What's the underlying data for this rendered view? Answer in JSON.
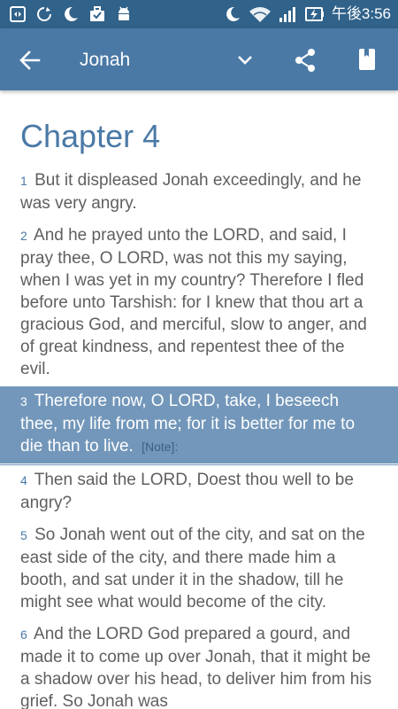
{
  "status_bar": {
    "time": "午後3:56",
    "icons": [
      "screen-icon",
      "sync-icon",
      "moon-icon",
      "briefcase-icon",
      "android-icon",
      "moon-icon",
      "wifi-icon",
      "signal-icon",
      "battery-charging-icon"
    ]
  },
  "app_bar": {
    "title": "Jonah",
    "icons": [
      "back-arrow-icon",
      "chevron-down-icon",
      "share-icon",
      "bookmark-icon"
    ]
  },
  "chapter": {
    "title": "Chapter 4",
    "verses": [
      {
        "number": "1",
        "text": "But it displeased Jonah exceedingly, and he was very angry."
      },
      {
        "number": "2",
        "text": "And he prayed unto the LORD, and said, I pray thee, O LORD, was not this my saying, when I was yet in my country? Therefore I fled before unto Tarshish: for I knew that thou art a gracious God, and merciful, slow to anger, and of great kindness, and repentest thee of the evil."
      },
      {
        "number": "3",
        "text": "Therefore now, O LORD, take, I beseech thee, my life from me; for it is better for me to die than to live.",
        "note": "[Note]:",
        "highlighted": true
      },
      {
        "number": "4",
        "text": "Then said the LORD, Doest thou well to be angry?"
      },
      {
        "number": "5",
        "text": "So Jonah went out of the city, and sat on the east side of the city, and there made him a booth, and sat under it in the shadow, till he might see what would become of the city."
      },
      {
        "number": "6",
        "text": "And the LORD God prepared a gourd, and made it to come up over Jonah, that it might be a shadow over his head, to deliver him from his grief. So Jonah was"
      }
    ]
  },
  "colors": {
    "status_bar": "#30628a",
    "app_bar": "#4a79a6",
    "highlight": "#7397ba",
    "verse_number": "#4a79a6",
    "text": "#5f5f5f"
  }
}
